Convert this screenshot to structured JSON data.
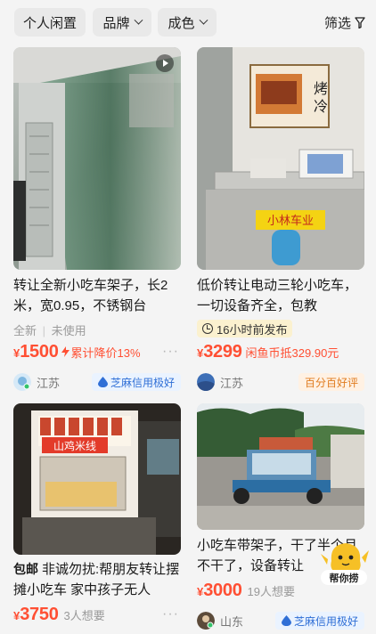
{
  "filters": {
    "chips": [
      "个人闲置",
      "品牌",
      "成色"
    ],
    "filter_label": "筛选"
  },
  "cards": [
    {
      "title": "转让全新小吃车架子，长2米，宽0.95，不锈钢台",
      "tags": [
        "全新",
        "未使用"
      ],
      "price_symbol": "¥",
      "price": "1500",
      "price_note": "累计降价13%",
      "location": "江苏",
      "badge": "芝麻信用极好",
      "has_video": true
    },
    {
      "title": "低价转让电动三轮小吃车，一切设备齐全，包教",
      "time_tag": "16小时前发布",
      "price_symbol": "¥",
      "price": "3299",
      "price_note": "闲鱼币抵329.90元",
      "location": "江苏",
      "badge": "百分百好评",
      "sign_text": "小林车业",
      "poster_text": "烤冷面"
    },
    {
      "badge_prefix": "包邮",
      "title": "非诚勿扰:帮朋友转让摆摊小吃车 家中孩子无人",
      "price_symbol": "¥",
      "price": "3750",
      "want": "3人想要",
      "sign_text": "山鸡米线"
    },
    {
      "title": "小吃车带架子，干了半个月不干了，设备转让",
      "price_symbol": "¥",
      "price": "3000",
      "want": "19人想要",
      "location": "山东",
      "badge": "芝麻信用极好"
    }
  ],
  "helper": {
    "label": "帮你捞"
  },
  "colors": {
    "price": "#ff4f33",
    "credit_badge": "#2f6fd6",
    "good_badge": "#e07c1f"
  }
}
